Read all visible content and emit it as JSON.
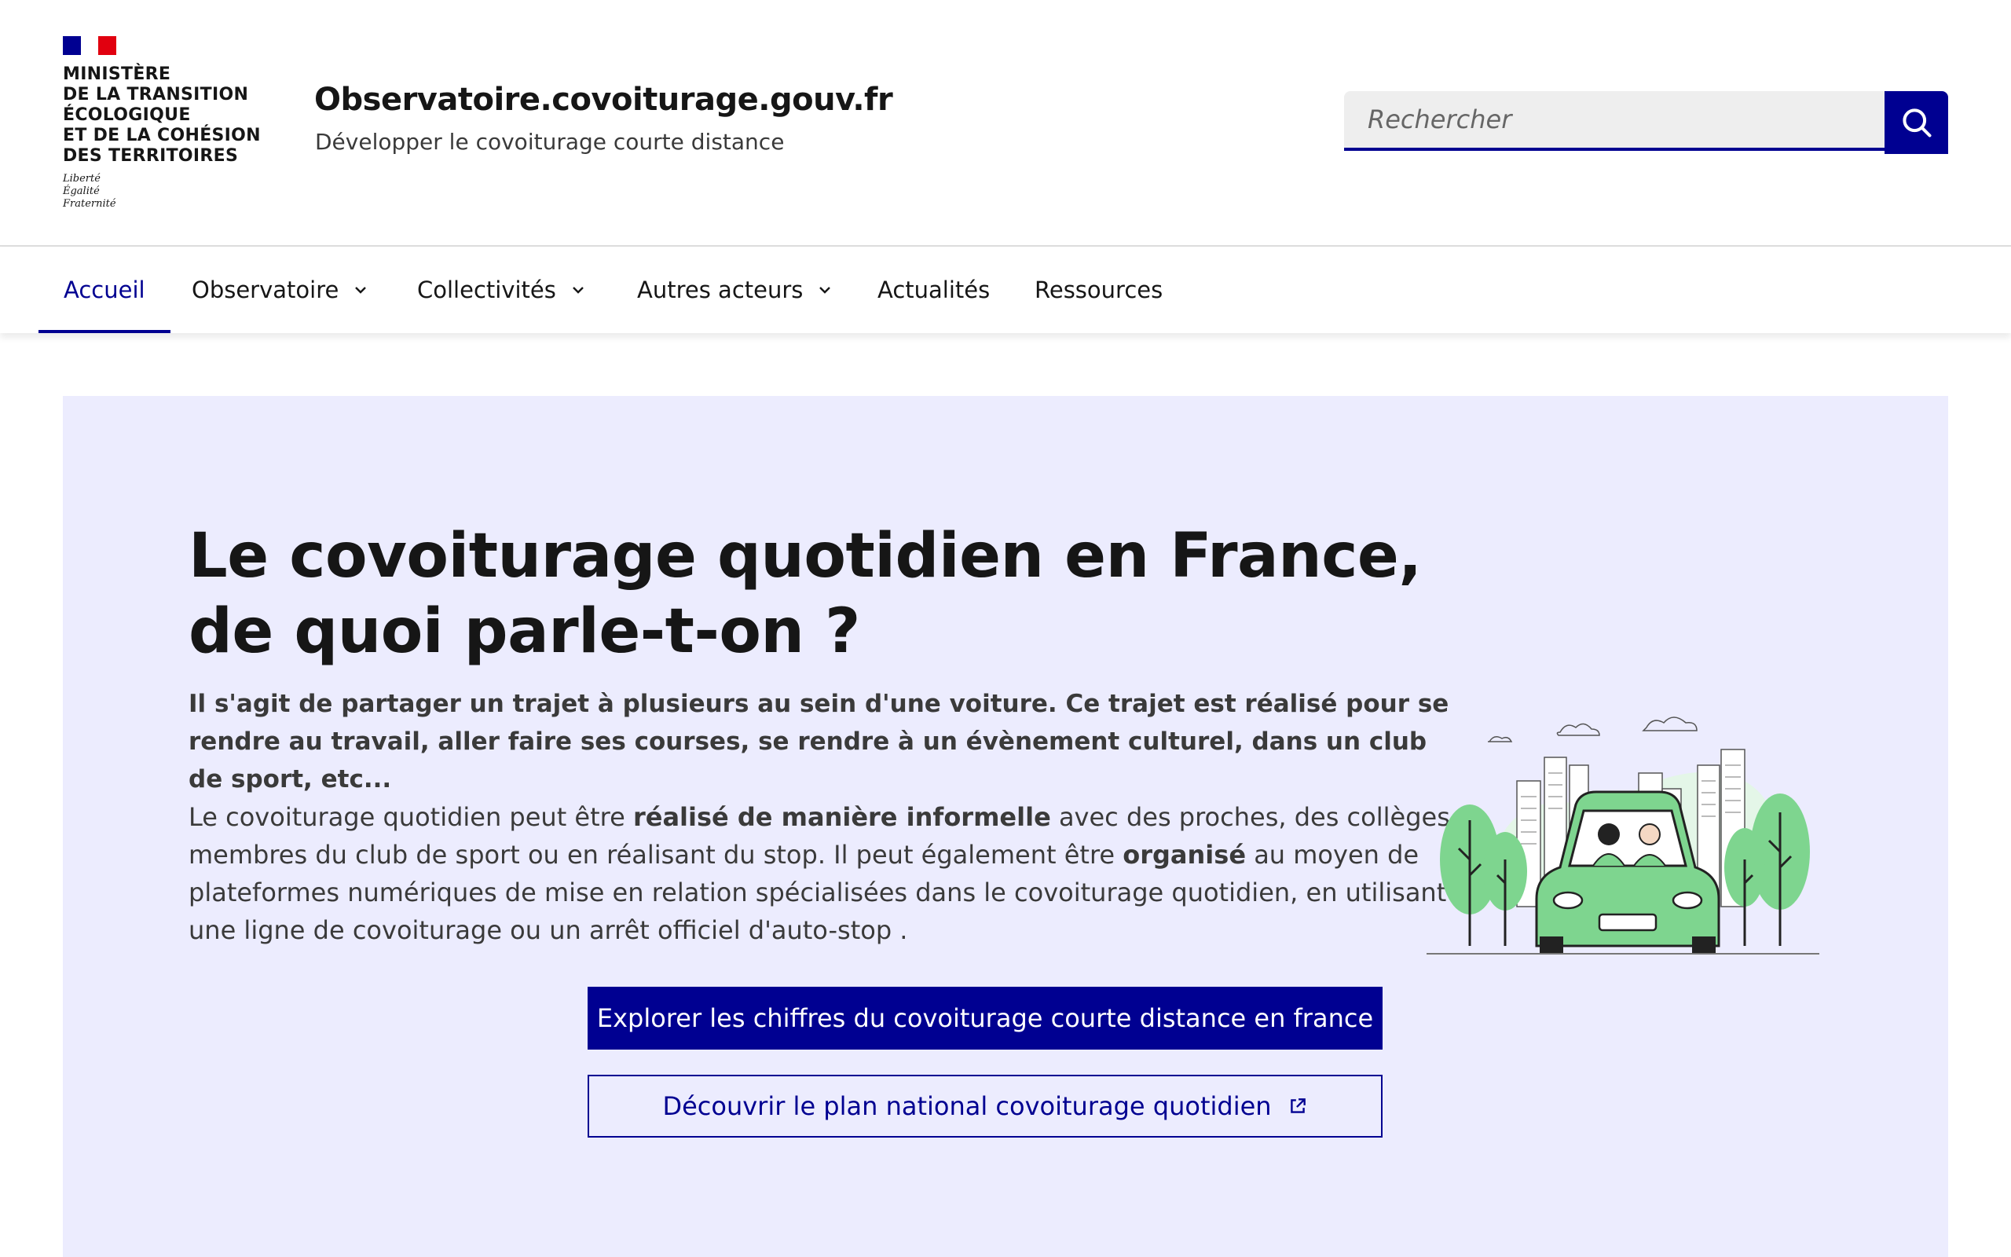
{
  "header": {
    "ministry": "Ministère\nde la transition\nécologique\net de la cohésion\ndes territoires",
    "motto": "Liberté\nÉgalité\nFraternité",
    "site_title": "Observatoire.covoiturage.gouv.fr",
    "site_tagline": "Développer le covoiturage courte distance",
    "search_placeholder": "Rechercher",
    "search_icon": "search-icon"
  },
  "nav": {
    "items": [
      {
        "label": "Accueil",
        "active": true
      },
      {
        "label": "Observatoire",
        "dropdown": true
      },
      {
        "label": "Collectivités",
        "dropdown": true
      },
      {
        "label": "Autres acteurs",
        "dropdown": true
      },
      {
        "label": "Actualités"
      },
      {
        "label": "Ressources"
      }
    ]
  },
  "hero": {
    "title": "Le covoiturage quotidien en France, de quoi parle-t-on ?",
    "lead": "Il s'agit de partager un trajet à plusieurs au sein d'une voiture. Ce trajet est réalisé pour se rendre au travail, aller faire ses courses, se rendre à un évènement culturel, dans un club de sport, etc...",
    "body": {
      "p1": "Le covoiturage quotidien peut être ",
      "b1": "réalisé de manière informelle",
      "p2": " avec des proches, des collèges, membres du club de sport ou en réalisant du stop. Il peut également être ",
      "b2": "organisé",
      "p3": " au moyen de plateformes numériques de mise en relation spécialisées dans le covoiturage quotidien, en utilisant une ligne de covoiturage ou un arrêt officiel d'auto-stop ."
    },
    "primary_button": "Explorer les chiffres du covoiturage courte distance en france",
    "secondary_button": "Découvrir le plan national covoiturage quotidien",
    "secondary_icon": "external-link-icon"
  },
  "colors": {
    "brand_blue": "#000091",
    "hero_bg": "#ececfe",
    "marianne_red": "#e1000f",
    "car_green": "#7ed58f"
  }
}
